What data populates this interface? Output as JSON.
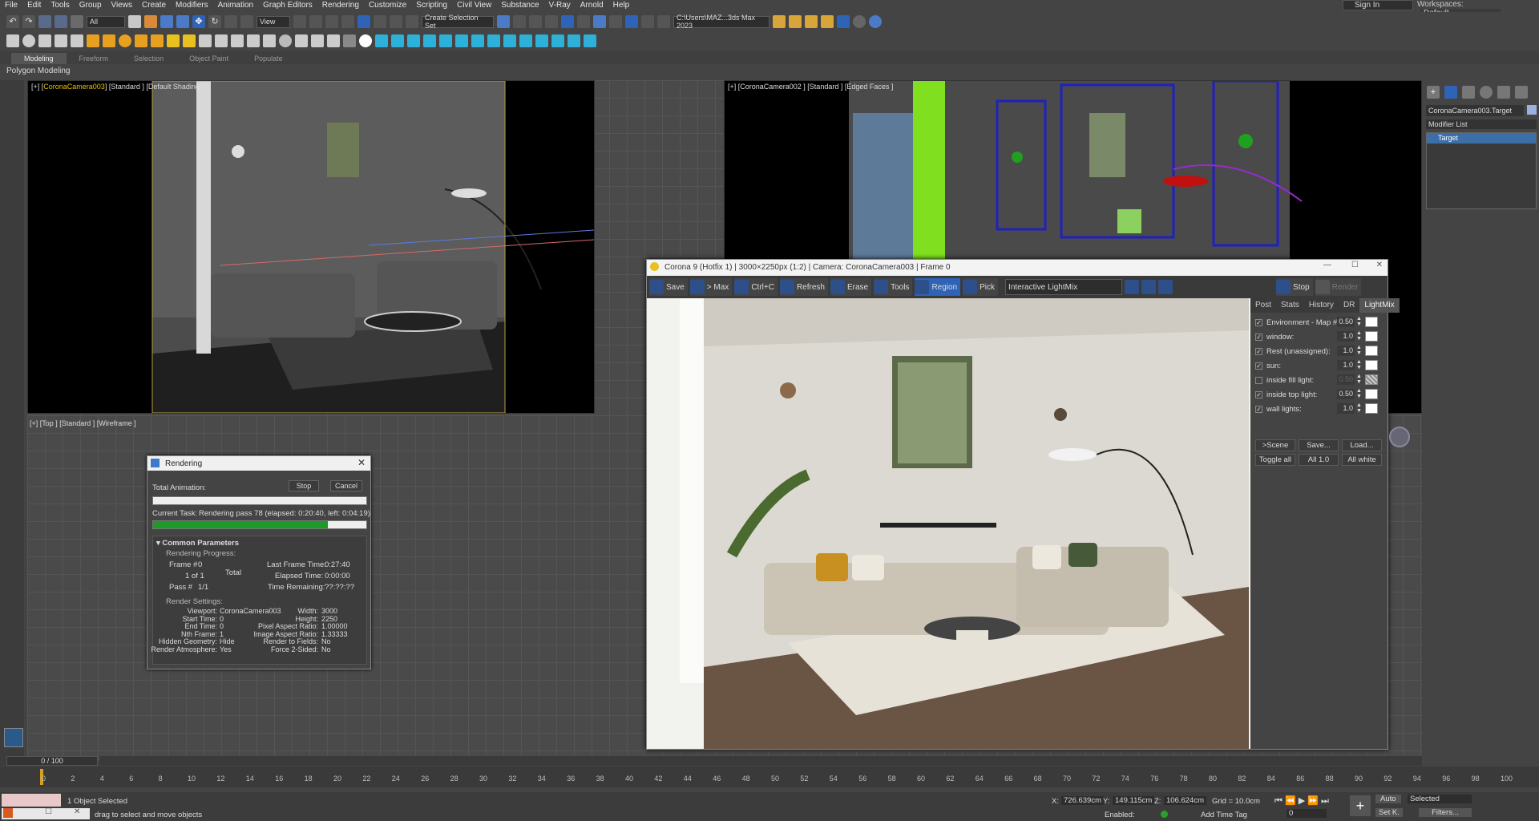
{
  "menu": [
    "File",
    "Edit",
    "Tools",
    "Group",
    "Views",
    "Create",
    "Modifiers",
    "Animation",
    "Graph Editors",
    "Rendering",
    "Customize",
    "Scripting",
    "Civil View",
    "Substance",
    "V-Ray",
    "Arnold",
    "Help"
  ],
  "signin": "Sign In",
  "workspaces_label": "Workspaces:",
  "workspaces_value": "Default",
  "toolbar": {
    "filter": "All",
    "view": "View",
    "selset": "Create Selection Set",
    "path": "C:\\Users\\MAZ...3ds Max 2023"
  },
  "ribbon_tabs": [
    "Modeling",
    "Freeform",
    "Selection",
    "Object Paint",
    "Populate"
  ],
  "ribbon_sub": "Polygon Modeling",
  "viewports": {
    "tl": {
      "label_pre": "[+] [",
      "camera": "CoronaCamera003",
      "label_post": "] [Standard ] [Default Shading ]"
    },
    "tr": {
      "label": "[+] [CoronaCamera002 ] [Standard ] [Edged Faces ]"
    },
    "bl": {
      "label": "[+] [Top ] [Standard ] [Wireframe ]"
    }
  },
  "command_panel": {
    "object_name": "CoronaCamera003.Target",
    "modifier_list": "Modifier List",
    "stack_item": "Target"
  },
  "render_dialog": {
    "title": "Rendering",
    "total_animation": "Total Animation:",
    "stop": "Stop",
    "cancel": "Cancel",
    "current_task_label": "Current Task:",
    "current_task": "Rendering pass 78 (elapsed: 0:20:40, left: 0:04:19)",
    "progress_total": 0.0,
    "progress_task": 0.82,
    "section": "Common Parameters",
    "rendering_progress": "Rendering Progress:",
    "frame_label": "Frame #",
    "frame": "0",
    "of_label": "1 of 1",
    "total": "Total",
    "pass_label": "Pass #",
    "pass": "1/1",
    "last_frame_time": "Last Frame Time:",
    "last_frame_value": "0:27:40",
    "elapsed_time": "Elapsed Time:",
    "elapsed_value": "0:00:00",
    "time_remaining": "Time Remaining:",
    "time_remaining_value": "??:??:??",
    "render_settings": "Render Settings:",
    "settings_left": [
      [
        "Viewport:",
        "CoronaCamera003"
      ],
      [
        "Start Time:",
        "0"
      ],
      [
        "End Time:",
        "0"
      ],
      [
        "Nth Frame:",
        "1"
      ],
      [
        "Hidden Geometry:",
        "Hide"
      ],
      [
        "Render Atmosphere:",
        "Yes"
      ]
    ],
    "settings_right": [
      [
        "Width:",
        "3000"
      ],
      [
        "Height:",
        "2250"
      ],
      [
        "Pixel Aspect Ratio:",
        "1.00000"
      ],
      [
        "Image Aspect Ratio:",
        "1.33333"
      ],
      [
        "Render to Fields:",
        "No"
      ],
      [
        "Force 2-Sided:",
        "No"
      ]
    ]
  },
  "corona": {
    "title": "Corona 9 (Hotfix 1) | 3000×2250px (1:2) | Camera: CoronaCamera003 | Frame 0",
    "buttons": [
      "Save",
      "> Max",
      "Ctrl+C",
      "Refresh",
      "Erase",
      "Tools",
      "Region",
      "Pick"
    ],
    "lightmix_mode": "Interactive LightMix",
    "stop": "Stop",
    "render": "Render",
    "tabs": [
      "Post",
      "Stats",
      "History",
      "DR",
      "LightMix"
    ],
    "lights": [
      {
        "name": "Environment - Map #",
        "checked": true,
        "value": "0.50"
      },
      {
        "name": "window:",
        "checked": true,
        "value": "1.0"
      },
      {
        "name": "Rest (unassigned):",
        "checked": true,
        "value": "1.0"
      },
      {
        "name": "sun:",
        "checked": true,
        "value": "1.0"
      },
      {
        "name": "inside fill light:",
        "checked": false,
        "value": "0.50"
      },
      {
        "name": "inside top light:",
        "checked": true,
        "value": "0.50"
      },
      {
        "name": "wall lights:",
        "checked": true,
        "value": "1.0"
      }
    ],
    "scene_btn": ">Scene",
    "save_btn": "Save...",
    "load_btn": "Load...",
    "toggle_all": "Toggle all",
    "all_1": "All 1.0",
    "all_white": "All white"
  },
  "timeline": {
    "frame_counter": "0 / 100",
    "ticks": [
      "0",
      "2",
      "4",
      "6",
      "8",
      "10",
      "12",
      "14",
      "16",
      "18",
      "20",
      "22",
      "24",
      "26",
      "28",
      "30",
      "32",
      "34",
      "36",
      "38",
      "40",
      "42",
      "44",
      "46",
      "48",
      "50",
      "52",
      "54",
      "56",
      "58",
      "60",
      "62",
      "64",
      "66",
      "68",
      "70",
      "72",
      "74",
      "76",
      "78",
      "80",
      "82",
      "84",
      "86",
      "88",
      "90",
      "92",
      "94",
      "96",
      "98",
      "100"
    ]
  },
  "status": {
    "selected": "1 Object Selected",
    "prompt": "drag to select and move objects",
    "x_label": "X:",
    "x": "726.639cm",
    "y_label": "Y:",
    "y": "149.115cm",
    "z_label": "Z:",
    "z": "106.624cm",
    "grid": "Grid = 10.0cm",
    "enabled": "Enabled:",
    "add_time_tag": "Add Time Tag",
    "auto": "Auto",
    "selected_dd": "Selected",
    "set_k": "Set K.",
    "filters": "Filters...",
    "frame_field": "0"
  }
}
